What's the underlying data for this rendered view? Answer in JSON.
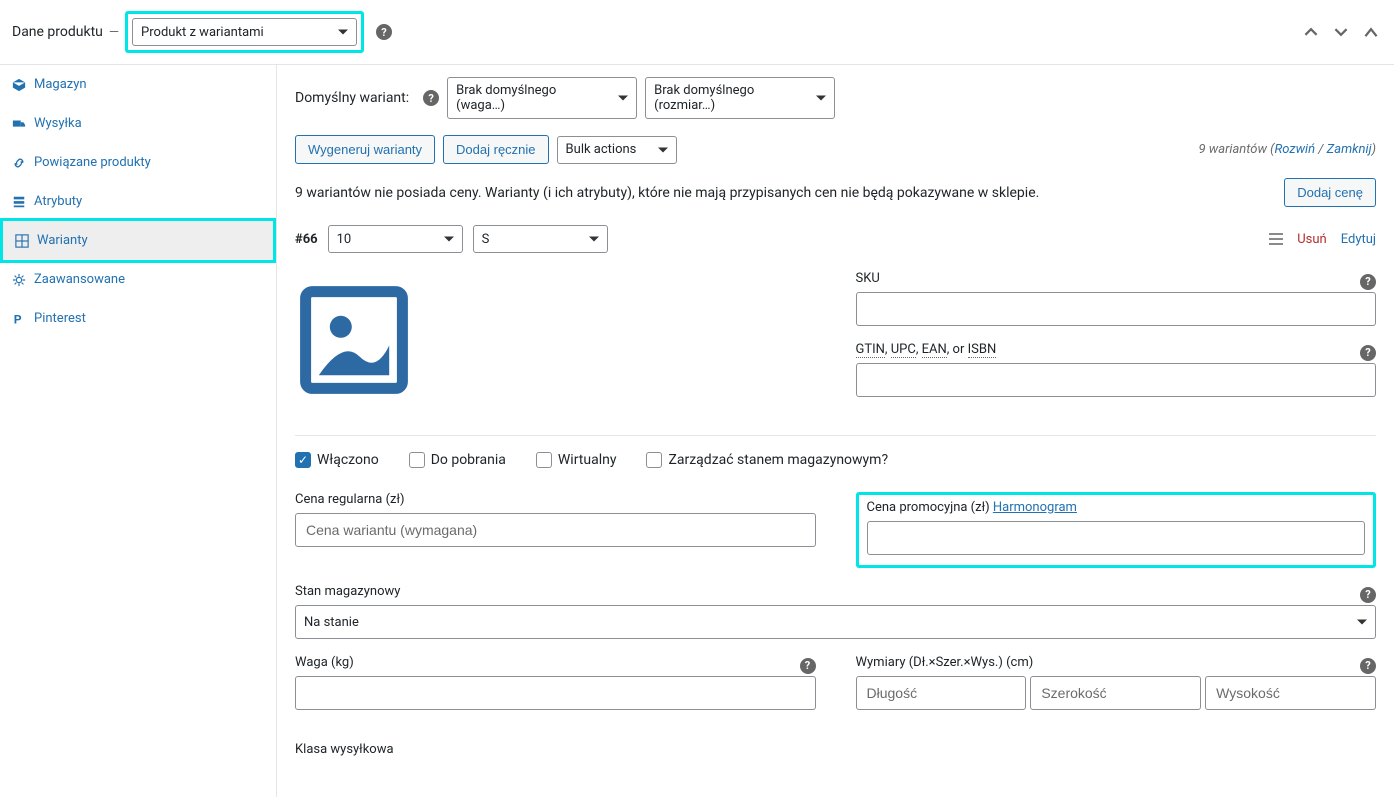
{
  "header": {
    "title": "Dane produktu",
    "product_type": "Produkt z wariantami"
  },
  "sidebar": {
    "items": [
      {
        "label": "Magazyn",
        "icon": "magazyn"
      },
      {
        "label": "Wysyłka",
        "icon": "wysylka"
      },
      {
        "label": "Powiązane produkty",
        "icon": "link"
      },
      {
        "label": "Atrybuty",
        "icon": "list"
      },
      {
        "label": "Warianty",
        "icon": "grid"
      },
      {
        "label": "Zaawansowane",
        "icon": "gear"
      },
      {
        "label": "Pinterest",
        "icon": "pinterest"
      }
    ]
  },
  "default_variant": {
    "label": "Domyślny wariant:",
    "selects": [
      "Brak domyślnego (waga…)",
      "Brak domyślnego (rozmiar…)"
    ]
  },
  "actions": {
    "generate": "Wygeneruj warianty",
    "add_manual": "Dodaj ręcznie",
    "bulk": "Bulk actions"
  },
  "status": {
    "count_text": "9 wariantów",
    "expand": "Rozwiń",
    "collapse": "Zamknij"
  },
  "warning": {
    "text": "9 wariantów nie posiada ceny. Warianty (i ich atrybuty), które nie mają przypisanych cen nie będą pokazywane w sklepie.",
    "add_price": "Dodaj cenę"
  },
  "variant": {
    "id": "#66",
    "attr1": "10",
    "attr2": "S",
    "remove": "Usuń",
    "edit": "Edytuj"
  },
  "fields": {
    "sku_label": "SKU",
    "gtin_label_a": "GTIN",
    "gtin_label_b": "UPC",
    "gtin_label_c": "EAN",
    "gtin_or": ", or ",
    "gtin_isbn": "ISBN",
    "gtin_sep": ", ",
    "enabled": "Włączono",
    "downloadable": "Do pobrania",
    "virtual": "Wirtualny",
    "manage_stock": "Zarządzać stanem magazynowym?",
    "regular_price_label": "Cena regularna (zł)",
    "regular_price_ph": "Cena wariantu (wymagana)",
    "sale_price_label": "Cena promocyjna (zł)",
    "schedule": "Harmonogram",
    "stock_label": "Stan magazynowy",
    "stock_value": "Na stanie",
    "weight_label": "Waga (kg)",
    "dims_label": "Wymiary (Dł.×Szer.×Wys.) (cm)",
    "dim_l_ph": "Długość",
    "dim_w_ph": "Szerokość",
    "dim_h_ph": "Wysokość",
    "ship_class_label": "Klasa wysyłkowa"
  }
}
